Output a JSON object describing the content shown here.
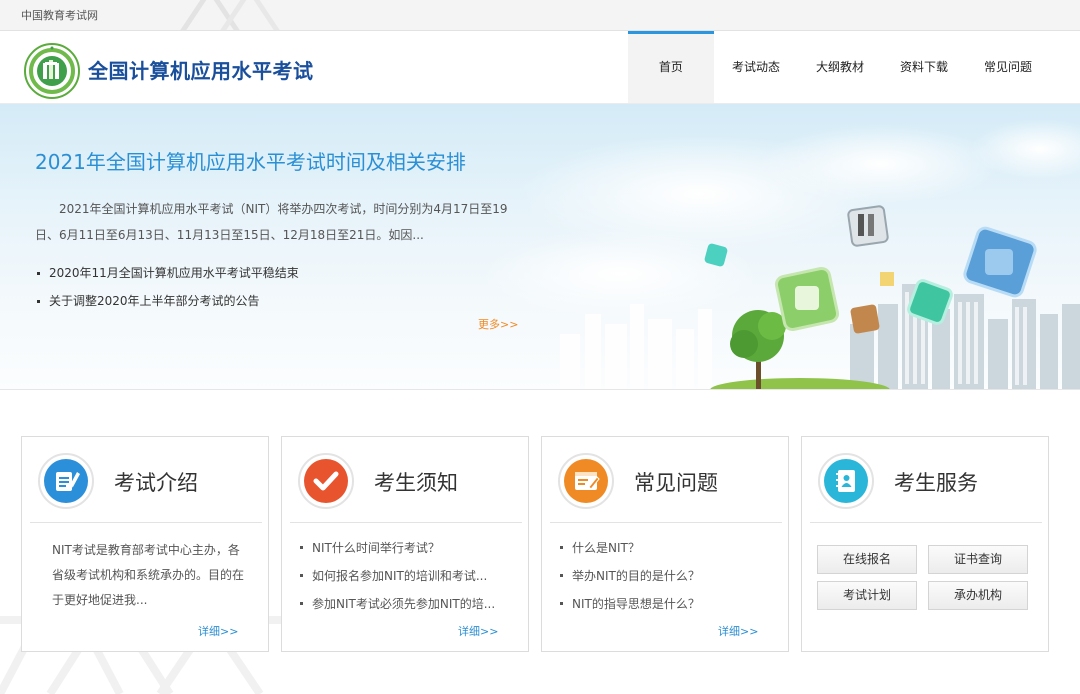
{
  "topbar": {
    "site_name": "中国教育考试网"
  },
  "header": {
    "site_title": "全国计算机应用水平考试"
  },
  "nav": [
    {
      "label": "首页",
      "active": true
    },
    {
      "label": "考试动态",
      "active": false
    },
    {
      "label": "大纲教材",
      "active": false
    },
    {
      "label": "资料下载",
      "active": false
    },
    {
      "label": "常见问题",
      "active": false
    }
  ],
  "banner": {
    "headline": "2021年全国计算机应用水平考试时间及相关安排",
    "summary": "2021年全国计算机应用水平考试（NIT）将举办四次考试，时间分别为4月17日至19日、6月11日至6月13日、11月13日至15日、12月18日至21日。如因...",
    "news": [
      "2020年11月全国计算机应用水平考试平稳结束",
      "关于调整2020年上半年部分考试的公告"
    ],
    "more": "更多>>"
  },
  "cards": {
    "intro": {
      "title": "考试介绍",
      "icon": "document-pen-icon",
      "text": "NIT考试是教育部考试中心主办，各省级考试机构和系统承办的。目的在于更好地促进我...",
      "detail": "详细>>"
    },
    "notice": {
      "title": "考生须知",
      "icon": "checkmark-icon",
      "items": [
        "NIT什么时间举行考试？",
        "如何报名参加NIT的培训和考试...",
        "参加NIT考试必须先参加NIT的培..."
      ],
      "detail": "详细>>"
    },
    "faq": {
      "title": "常见问题",
      "icon": "browser-edit-icon",
      "items": [
        "什么是NIT？",
        "举办NIT的目的是什么？",
        "NIT的指导思想是什么？"
      ],
      "detail": "详细>>"
    },
    "service": {
      "title": "考生服务",
      "icon": "address-book-icon",
      "buttons": [
        "在线报名",
        "证书查询",
        "考试计划",
        "承办机构"
      ]
    }
  },
  "colors": {
    "brand_blue": "#1a4f9c",
    "link_blue": "#2a8fd4",
    "accent_orange": "#f08a24",
    "nav_active": "#2b96e0",
    "icon_blue": "#2b8fd9",
    "icon_red": "#e8542e",
    "icon_orange": "#f08a24",
    "icon_cyan": "#29b6d8"
  }
}
